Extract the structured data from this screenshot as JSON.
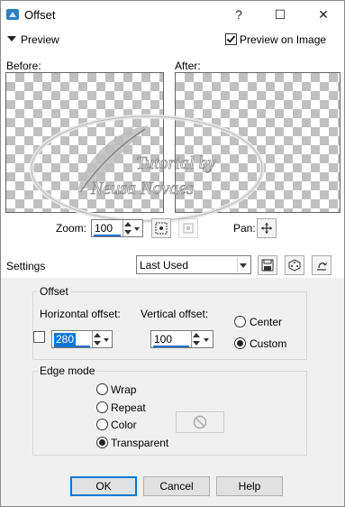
{
  "window": {
    "title": "Offset",
    "help_icon": "?",
    "minimize_icon": "—",
    "maximize_icon": "☐",
    "close_icon": "✕"
  },
  "preview": {
    "section_label": "Preview",
    "preview_on_image_label": "Preview on Image",
    "preview_on_image_checked": true,
    "before_label": "Before:",
    "after_label": "After:",
    "zoom_label": "Zoom:",
    "zoom_value": "100",
    "pan_label": "Pan:"
  },
  "settings": {
    "label": "Settings",
    "preset_value": "Last Used"
  },
  "offset": {
    "group_title": "Offset",
    "horizontal_label": "Horizontal offset:",
    "horizontal_value": "280",
    "vertical_label": "Vertical offset:",
    "vertical_value": "100",
    "link_checkbox_checked": false,
    "center_label": "Center",
    "custom_label": "Custom",
    "selected_mode": "Custom"
  },
  "edge_mode": {
    "group_title": "Edge mode",
    "options": [
      "Wrap",
      "Repeat",
      "Color",
      "Transparent"
    ],
    "selected": "Transparent"
  },
  "watermark": {
    "line1": "Tutorial by",
    "line2": "Neusa Novaes"
  },
  "buttons": {
    "ok": "OK",
    "cancel": "Cancel",
    "help": "Help"
  },
  "colors": {
    "accent": "#0078d7",
    "panel_bg": "#f0f0f0",
    "checker_dark": "#c0c0c0"
  }
}
